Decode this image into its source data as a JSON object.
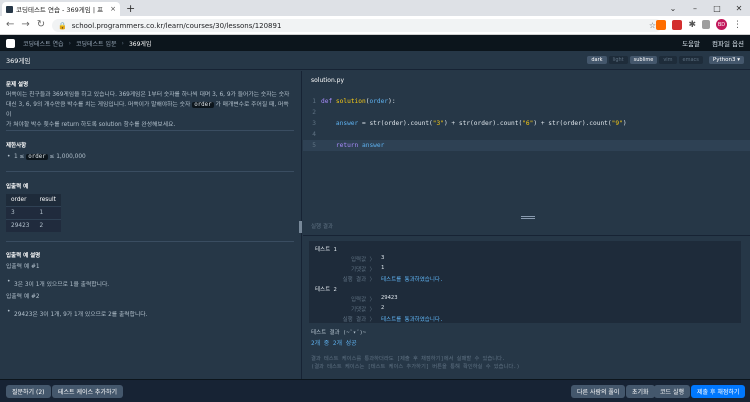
{
  "browser": {
    "tab_title": "코딩테스트 연습 - 369게임 | 프",
    "tab_close": "×",
    "newtab": "+",
    "url": "school.programmers.co.kr/learn/courses/30/lessons/120891",
    "profile": "BD",
    "icons": [
      "back-icon",
      "forward-icon",
      "reload-icon",
      "lock-icon",
      "star-icon",
      "extensions-icon",
      "puzzle-icon",
      "menu-icon"
    ]
  },
  "header": {
    "breadcrumbs": [
      "코딩테스트 연습",
      "코딩테스트 입문",
      "369게임"
    ],
    "breadcrumb_sep": "›",
    "right_links": [
      "도움말",
      "컴파일 옵션"
    ]
  },
  "lesson": {
    "title": "369게임",
    "themes": [
      "dark",
      "light",
      "sublime",
      "vim",
      "emacs"
    ],
    "active_theme": "sublime",
    "language": "Python3 ▾"
  },
  "problem": {
    "desc_heading": "문제 설명",
    "desc_line1": "머쓱이는 친구들과 369게임을 하고 있습니다. 369게임은 1부터 숫자를 하나씩 대며 3, 6, 9가 들어가는 숫자는 숫자",
    "desc_line2": "대신 3, 6, 9의 개수만큼 박수를 치는 게임입니다. 머쓱이가 말해야하는 숫자",
    "desc_code": "order",
    "desc_line2b": "가 매개변수로 주어질 때, 머쓱이",
    "desc_line3": "가 쳐야할 박수 횟수를 return 하도록 solution 함수를 완성해보세요.",
    "constraints_heading": "제한사항",
    "constraint_pre": "1 ≤",
    "constraint_code": "order",
    "constraint_post": "≤ 1,000,000",
    "io_heading": "입출력 예",
    "io_columns": [
      "order",
      "result"
    ],
    "io_rows": [
      [
        "3",
        "1"
      ],
      [
        "29423",
        "2"
      ]
    ],
    "explain_heading": "입출력 예 설명",
    "ex1_title": "입출력 예 #1",
    "ex1_text": "3은 3이 1개 있으므로 1을 출력합니다.",
    "ex2_title": "입출력 예 #2",
    "ex2_text": "29423은 3이 1개, 9가 1개 있으므로 2를 출력합니다."
  },
  "editor": {
    "filename": "solution.py",
    "lines": [
      "1",
      "2",
      "3",
      "4",
      "5"
    ]
  },
  "results": {
    "heading": "실행 결과",
    "cases": [
      {
        "title": "테스트 1",
        "in_label": "입력값 〉",
        "in_val": "3",
        "exp_label": "기댓값 〉",
        "exp_val": "1",
        "res_label": "실행 결과 〉",
        "res_val": "테스트를 통과하였습니다."
      },
      {
        "title": "테스트 2",
        "in_label": "입력값 〉",
        "in_val": "29423",
        "exp_label": "기댓값 〉",
        "exp_val": "2",
        "res_label": "실행 결과 〉",
        "res_val": "테스트를 통과하였습니다."
      }
    ],
    "summary_label": "테스트 결과 (~˘▾˘)~",
    "summary": "2개 중 2개 성공",
    "note1": "결과 테스트 케이스를 통과하더라도 [제출 후 채점하기]에서 실패할 수 있습니다.",
    "note2": "(결과 테스트 케이스는 [테스트 케이스 추가하기] 버튼을 통해 확인하실 수 있습니다.)"
  },
  "footer": {
    "question": "질문하기 (2)",
    "add_case": "테스트 케이스 추가하기",
    "others": "다른 사람의 풀이",
    "reset": "초기화",
    "run": "코드 실행",
    "submit": "제출 후 채점하기"
  }
}
